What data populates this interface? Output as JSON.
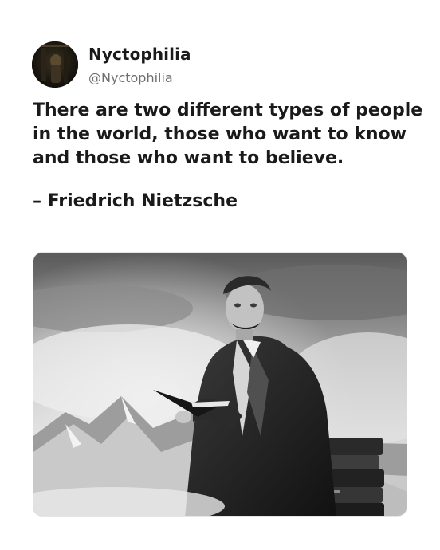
{
  "author_profile": {
    "display_name": "Nyctophilia",
    "handle": "@Nyctophilia"
  },
  "post": {
    "quote_lines": [
      "There are two different types of people",
      "in the world, those who want to know",
      "and those who want to believe."
    ],
    "attribution": "– Friedrich Nietzsche"
  }
}
